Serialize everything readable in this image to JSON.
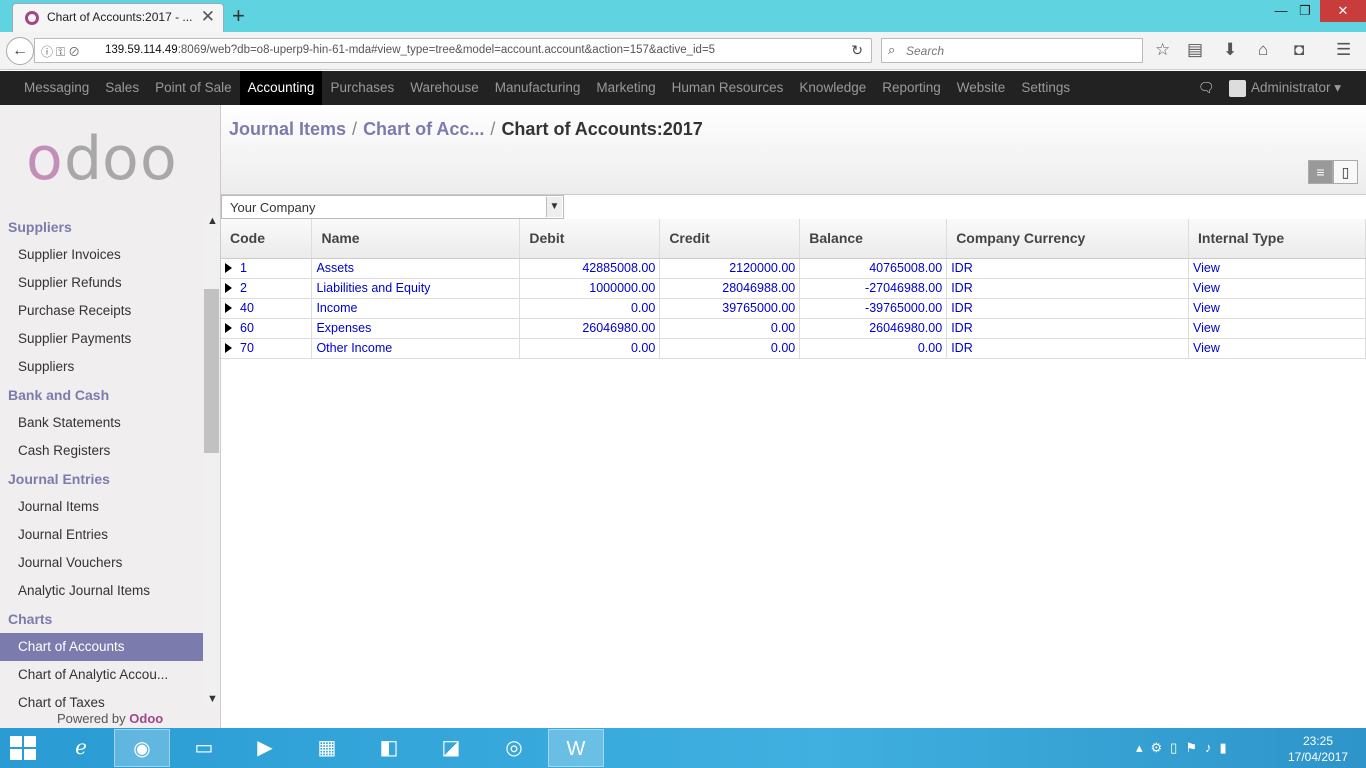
{
  "browser": {
    "tab_title": "Chart of Accounts:2017 - ...",
    "tab_close": "✕",
    "new_tab": "+",
    "url_host": "139.59.114.49",
    "url_rest": ":8069/web?db=o8-uperp9-hin-61-mda#view_type=tree&model=account.account&action=157&active_id=5",
    "search_placeholder": "Search"
  },
  "topmenu": {
    "items": [
      "Messaging",
      "Sales",
      "Point of Sale",
      "Accounting",
      "Purchases",
      "Warehouse",
      "Manufacturing",
      "Marketing",
      "Human Resources",
      "Knowledge",
      "Reporting",
      "Website",
      "Settings"
    ],
    "active": "Accounting",
    "user": "Administrator ▾"
  },
  "logo": {
    "text": "odoo"
  },
  "sidebar": {
    "sections": [
      {
        "title": "Suppliers",
        "items": [
          "Supplier Invoices",
          "Supplier Refunds",
          "Purchase Receipts",
          "Supplier Payments",
          "Suppliers"
        ]
      },
      {
        "title": "Bank and Cash",
        "items": [
          "Bank Statements",
          "Cash Registers"
        ]
      },
      {
        "title": "Journal Entries",
        "items": [
          "Journal Items",
          "Journal Entries",
          "Journal Vouchers",
          "Analytic Journal Items"
        ]
      },
      {
        "title": "Charts",
        "items": [
          "Chart of Accounts",
          "Chart of Analytic Accou...",
          "Chart of Taxes"
        ]
      }
    ],
    "active_item": "Chart of Accounts",
    "powered_by": "Powered by",
    "powered_brand": "Odoo"
  },
  "breadcrumb": {
    "item1": "Journal Items",
    "item2": "Chart of Acc...",
    "current": "Chart of Accounts:2017",
    "sep": "/"
  },
  "filter": {
    "company": "Your Company"
  },
  "table": {
    "columns": [
      "Code",
      "Name",
      "Debit",
      "Credit",
      "Balance",
      "Company Currency",
      "Internal Type"
    ],
    "rows": [
      {
        "code": "1",
        "name": "Assets",
        "debit": "42885008.00",
        "credit": "2120000.00",
        "balance": "40765008.00",
        "currency": "IDR",
        "type": "View"
      },
      {
        "code": "2",
        "name": "Liabilities and Equity",
        "debit": "1000000.00",
        "credit": "28046988.00",
        "balance": "-27046988.00",
        "currency": "IDR",
        "type": "View"
      },
      {
        "code": "40",
        "name": "Income",
        "debit": "0.00",
        "credit": "39765000.00",
        "balance": "-39765000.00",
        "currency": "IDR",
        "type": "View"
      },
      {
        "code": "60",
        "name": "Expenses",
        "debit": "26046980.00",
        "credit": "0.00",
        "balance": "26046980.00",
        "currency": "IDR",
        "type": "View"
      },
      {
        "code": "70",
        "name": "Other Income",
        "debit": "0.00",
        "credit": "0.00",
        "balance": "0.00",
        "currency": "IDR",
        "type": "View"
      }
    ]
  },
  "taskbar": {
    "time": "23:25",
    "date": "17/04/2017"
  },
  "colors": {
    "accent": "#7c7bad",
    "brand": "#a24689",
    "link": "#0000cc"
  }
}
